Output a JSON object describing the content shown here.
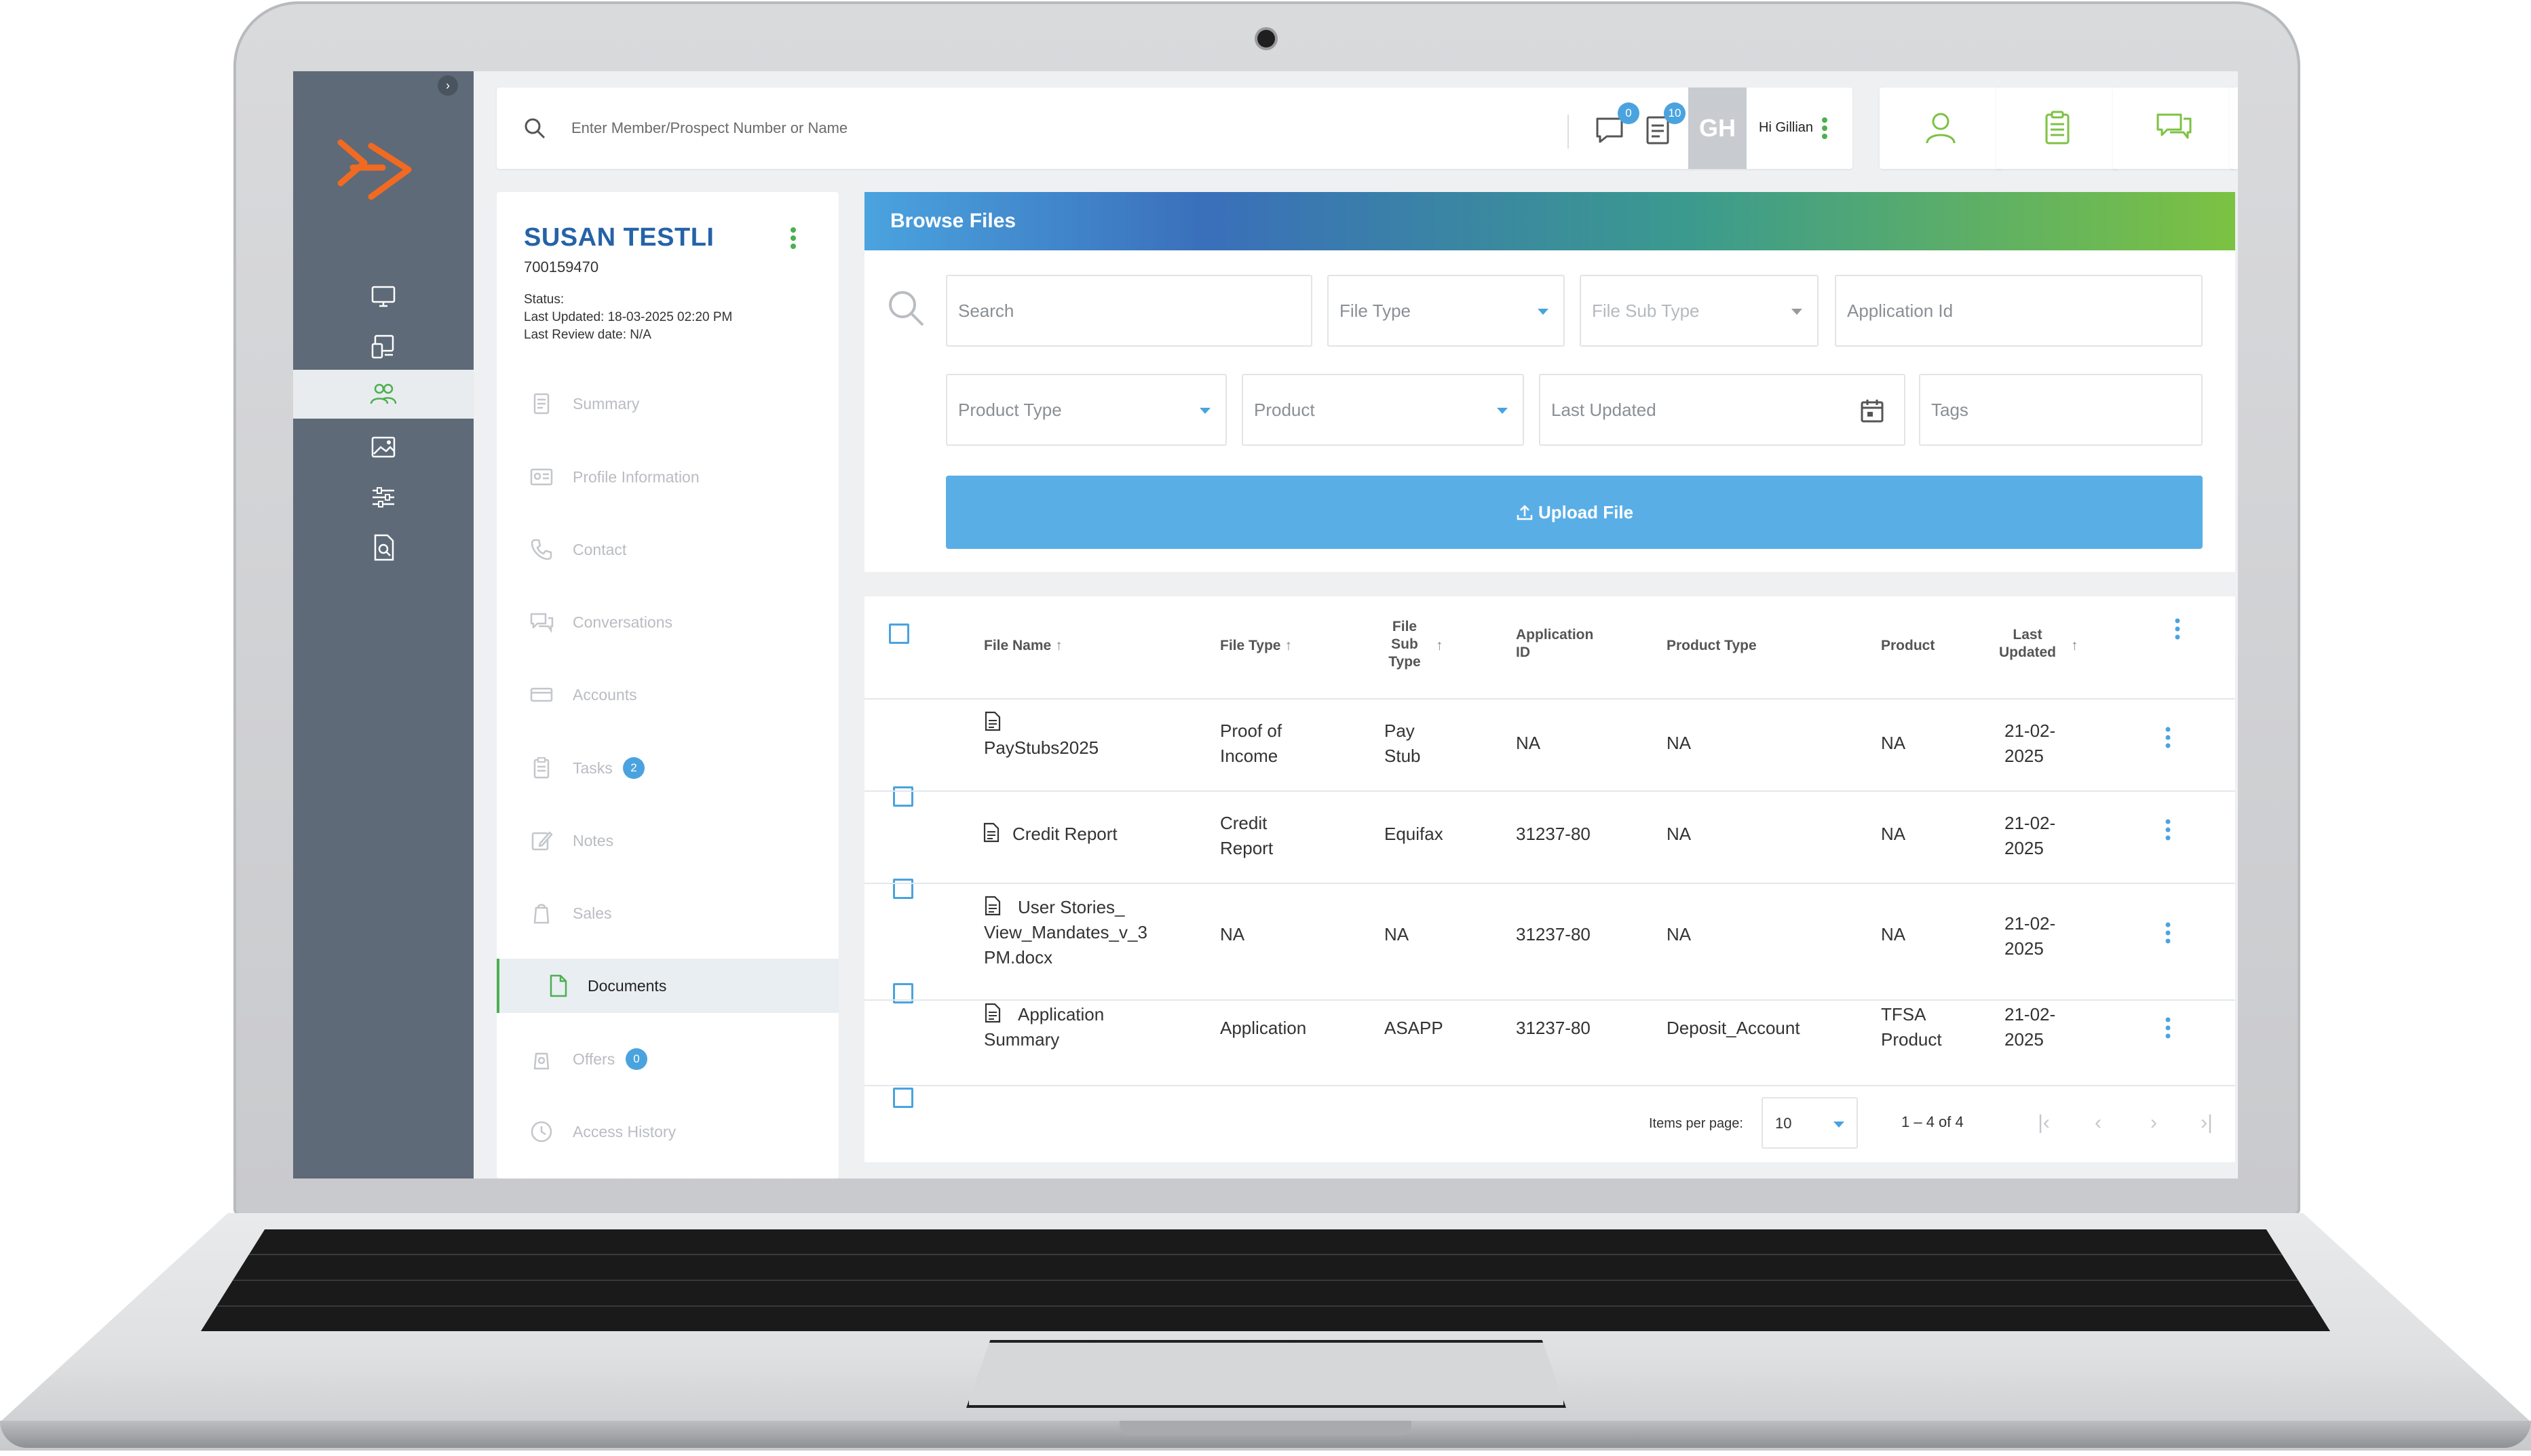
{
  "colors": {
    "nav_bg": "#5e6a77",
    "accent_blue": "#4aa3df",
    "name_blue": "#2563a8",
    "accent_green": "#7cc242",
    "logo_orange": "#f26a21"
  },
  "topbar": {
    "search_placeholder": "Enter Member/Prospect Number or Name",
    "messages_count": "0",
    "tasks_count": "10",
    "avatar_initials": "GH",
    "greeting": "Hi Gillian"
  },
  "leftnav": {
    "items": [
      {
        "icon": "monitor-icon"
      },
      {
        "icon": "devices-icon"
      },
      {
        "icon": "users-icon",
        "active": true
      },
      {
        "icon": "image-icon"
      },
      {
        "icon": "sliders-icon"
      },
      {
        "icon": "document-search-icon"
      }
    ]
  },
  "quick_actions": [
    {
      "icon": "user-icon"
    },
    {
      "icon": "clipboard-icon"
    },
    {
      "icon": "chat-icon"
    }
  ],
  "member": {
    "name": "SUSAN TESTLI",
    "number": "700159470",
    "status": "Status:",
    "last_updated": "Last Updated: 18-03-2025 02:20 PM",
    "last_review": "Last Review date: N/A",
    "menu": [
      {
        "label": "Summary",
        "icon": "summary-icon"
      },
      {
        "label": "Profile Information",
        "icon": "profile-icon"
      },
      {
        "label": "Contact",
        "icon": "phone-icon"
      },
      {
        "label": "Conversations",
        "icon": "conversations-icon"
      },
      {
        "label": "Accounts",
        "icon": "accounts-icon"
      },
      {
        "label": "Tasks",
        "icon": "tasks-icon",
        "badge": "2"
      },
      {
        "label": "Notes",
        "icon": "notes-icon"
      },
      {
        "label": "Sales",
        "icon": "sales-icon"
      },
      {
        "label": "Documents",
        "icon": "documents-icon",
        "active": true
      },
      {
        "label": "Offers",
        "icon": "offers-icon",
        "badge": "0"
      },
      {
        "label": "Access History",
        "icon": "history-icon"
      }
    ]
  },
  "browse": {
    "title": "Browse Files",
    "search_placeholder": "Search",
    "file_type": "File Type",
    "file_sub_type": "File Sub Type",
    "application_id": "Application Id",
    "product_type": "Product Type",
    "product": "Product",
    "last_updated": "Last Updated",
    "tags": "Tags",
    "upload_label": "Upload File"
  },
  "table": {
    "headers": {
      "file_name": "File Name",
      "file_type": "File Type",
      "file_sub_type_1": "File",
      "file_sub_type_2": "Sub",
      "file_sub_type_3": "Type",
      "application_id_1": "Application",
      "application_id_2": "ID",
      "product_type": "Product Type",
      "product": "Product",
      "last_updated_1": "Last",
      "last_updated_2": "Updated",
      "sort_arrow": "↑"
    },
    "rows": [
      {
        "file_name": [
          "",
          "PayStubs2025"
        ],
        "file_type": [
          "Proof of",
          "Income"
        ],
        "file_sub_type": [
          "Pay",
          "Stub"
        ],
        "application_id": "NA",
        "product_type": "NA",
        "product": [
          "NA"
        ],
        "last_updated": [
          "21-02-",
          "2025"
        ]
      },
      {
        "file_name": [
          "Credit Report"
        ],
        "file_type": [
          "Credit",
          "Report"
        ],
        "file_sub_type": [
          "Equifax"
        ],
        "application_id": "31237-80",
        "product_type": "NA",
        "product": [
          "NA"
        ],
        "last_updated": [
          "21-02-",
          "2025"
        ]
      },
      {
        "file_name": [
          "User Stories_",
          "View_Mandates_v_3",
          "PM.docx"
        ],
        "file_type": [
          "NA"
        ],
        "file_sub_type": [
          "NA"
        ],
        "application_id": "31237-80",
        "product_type": "NA",
        "product": [
          "NA"
        ],
        "last_updated": [
          "21-02-",
          "2025"
        ]
      },
      {
        "file_name": [
          "Application",
          "Summary"
        ],
        "file_type": [
          "Application"
        ],
        "file_sub_type": [
          "ASAPP"
        ],
        "application_id": "31237-80",
        "product_type": "Deposit_Account",
        "product": [
          "TFSA",
          "Product"
        ],
        "last_updated": [
          "21-02-",
          "2025"
        ]
      }
    ],
    "pager": {
      "items_per_page_label": "Items per page:",
      "items_per_page": "10",
      "range": "1 – 4 of 4",
      "first": "|‹",
      "prev": "‹",
      "next": "›",
      "last": "›|"
    }
  }
}
